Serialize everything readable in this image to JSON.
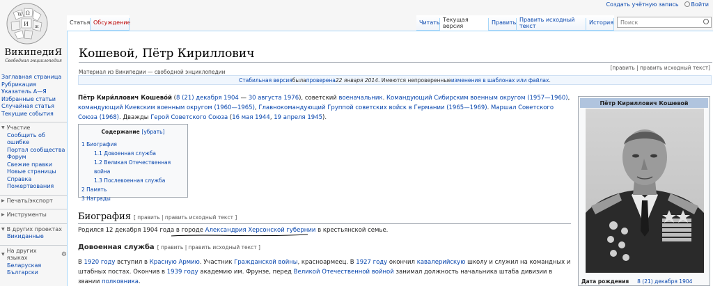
{
  "personal": {
    "create_account": "Создать учётную запись",
    "login": "Войти"
  },
  "logo": {
    "wordmark": "ВикипедиЯ",
    "tagline": "Свободная энциклопедия"
  },
  "nav": {
    "main": [
      "Заглавная страница",
      "Рубрикация",
      "Указатель А—Я",
      "Избранные статьи",
      "Случайная статья",
      "Текущие события"
    ],
    "participation": {
      "title": "Участие",
      "items": [
        "Сообщить об ошибке",
        "Портал сообщества",
        "Форум",
        "Свежие правки",
        "Новые страницы",
        "Справка",
        "Пожертвования"
      ]
    },
    "print": "Печать/экспорт",
    "tools": "Инструменты",
    "projects": {
      "title": "В других проектах",
      "items": [
        "Викиданные"
      ]
    },
    "langs": {
      "title": "На других языках",
      "items": [
        "Беларуская",
        "Български"
      ]
    }
  },
  "tabs": {
    "article": "Статья",
    "talk": "Обсуждение",
    "read": "Читать",
    "current": "Текущая версия",
    "edit": "Править",
    "edit_source": "Править исходный текст",
    "history": "История",
    "search_placeholder": "Поиск"
  },
  "colors": {
    "link": "#0645ad",
    "talk": "#ba0000",
    "infobox_head": "#b0c4de"
  },
  "article": {
    "title": "Кошевой, Пётр Кириллович",
    "sitesub": "Материал из Википедии — свободной энциклопедии",
    "page_edit": "[править | править исходный текст]",
    "flagged": {
      "p1": "Стабильная версия",
      "p2": " была ",
      "p3": "проверена",
      "p4": " 22 января 2014",
      "p5": ". Имеются непроверенные ",
      "p6": "изменения в шаблонах или файлах",
      "p7": "."
    },
    "lead": {
      "name": "Пётр Кири́ллович Кошево́й",
      "b1": " (",
      "birth": "8 (21) декабря 1904",
      "dash": " — ",
      "death": "30 августа 1976",
      "b2": "), советский ",
      "role": "военачальник",
      "b3": ". ",
      "c1": "Командующий Сибирским военным округом (1957—1960)",
      "s1": ", ",
      "c2": "командующий Киевским военным округом (1960—1965)",
      "s2": ", ",
      "c3": "Главнокомандующий Группой советских войск в Германии (1965—1969)",
      "s3": ". ",
      "c4": "Маршал Советского Союза (1968)",
      "s4": ". Дважды ",
      "hero": "Герой Советского Союза",
      "s5": " (",
      "d1": "16 мая 1944",
      "s6": ", ",
      "d2": "19 апреля 1945",
      "s7": ")."
    },
    "toc": {
      "title": "Содержание",
      "toggle": "[убрать]",
      "items": [
        "1 Биография",
        "1.1 Довоенная служба",
        "1.2 Великая Отечественная война",
        "1.3 Послевоенная служба",
        "2 Память",
        "3 Награды"
      ]
    },
    "bio": {
      "heading": "Биография",
      "edit": "[ править | править исходный текст ]",
      "t1": "Родился 12 декабря 1904 года в городе ",
      "city": "Александрия",
      "t2": " ",
      "gub": "Херсонской губернии",
      "t3": " в крестьянской семье."
    },
    "war": {
      "heading": "Довоенная служба",
      "edit": "[ править | править исходный текст ]",
      "t0": "В ",
      "y1920": "1920 году",
      "t1": " вступил в ",
      "ra": "Красную Армию",
      "t2": ". Участник ",
      "cw": "Гражданской войны",
      "t3": ", красноармеец. В ",
      "y1927": "1927 году",
      "t4": " окончил ",
      "cav": "кавалерийскую",
      "t5": " школу и служил на командных и штабных постах. Окончив в ",
      "y1939": "1939 году",
      "t6": " академию им. Фрунзе, перед ",
      "gpw": "Великой Отечественной войной",
      "t7": " занимал должность начальника штаба дивизии в звании ",
      "rank": "полковника",
      "t8": "."
    },
    "infobox": {
      "title": "Пётр Кириллович Кошевой",
      "birth_label": "Дата рождения",
      "birth_value": "8 (21) декабря 1904"
    }
  }
}
